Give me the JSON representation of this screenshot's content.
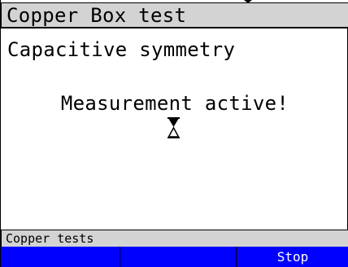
{
  "header": {
    "title": "Copper Box test"
  },
  "main": {
    "test_name": "Capacitive symmetry",
    "status_message": "Measurement active!",
    "busy_indicator": "hourglass-icon"
  },
  "footer": {
    "section_label": "Copper tests",
    "softkeys": [
      {
        "label": ""
      },
      {
        "label": ""
      },
      {
        "label": "Stop"
      }
    ]
  },
  "colors": {
    "bar_gray": "#d3d3d3",
    "softkey_blue": "#0000ff",
    "softkey_text": "#ffffff",
    "text": "#000000"
  }
}
